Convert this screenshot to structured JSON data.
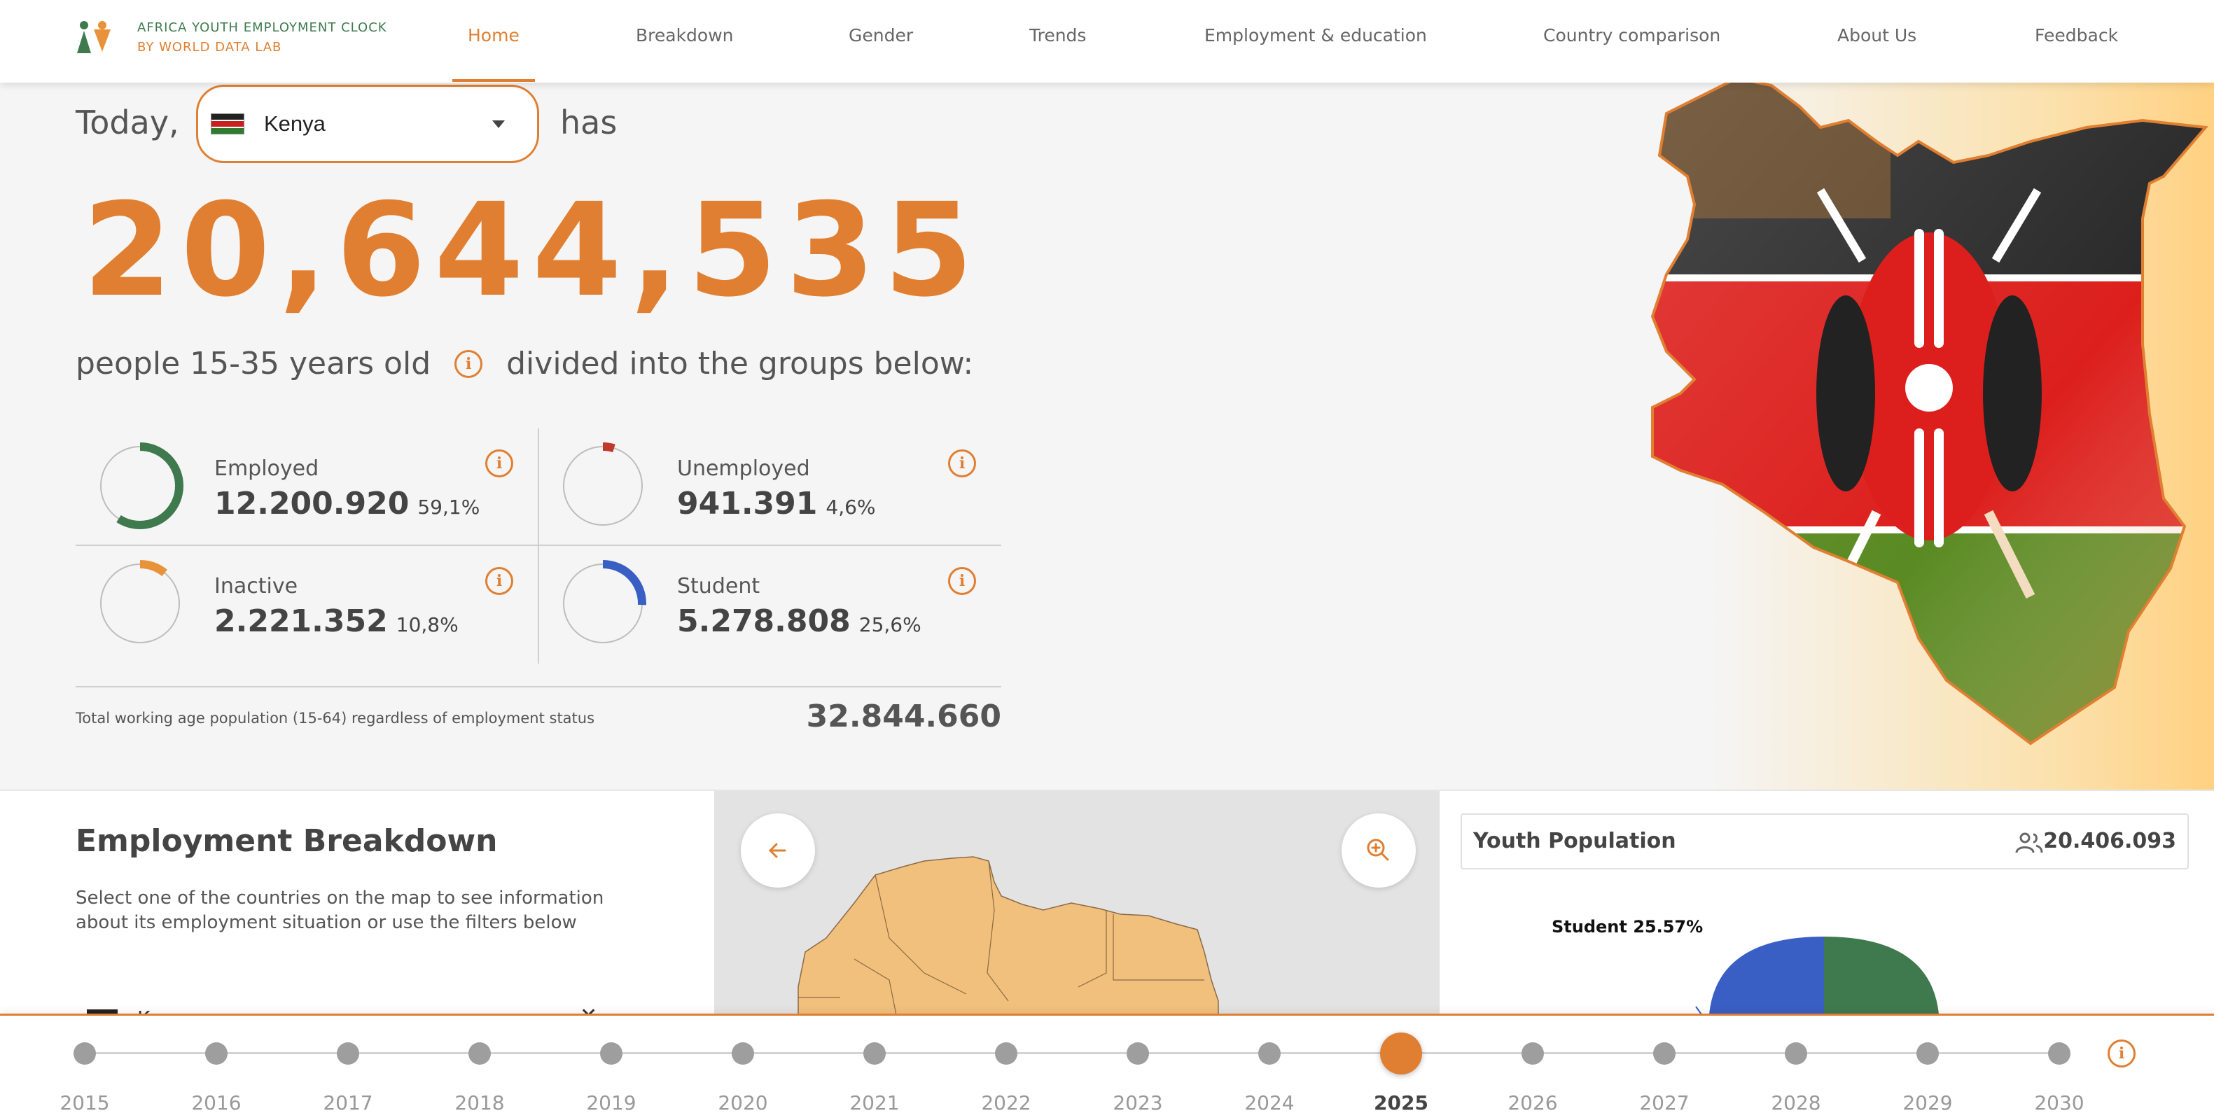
{
  "brand": {
    "line1": "AFRICA YOUTH EMPLOYMENT CLOCK",
    "line2": "BY WORLD DATA LAB"
  },
  "nav": {
    "items": [
      "Home",
      "Breakdown",
      "Gender",
      "Trends",
      "Employment & education",
      "Country comparison",
      "About Us",
      "Feedback"
    ],
    "active": "Home"
  },
  "hero": {
    "today_label": "Today,",
    "has_label": "has",
    "country_select": "Kenya",
    "youth_count": "20,644,535",
    "people_prefix": "people 15-35 years old",
    "people_suffix": "divided into the groups below:",
    "groups": [
      {
        "label": "Employed",
        "value": "12.200.920",
        "pct": "59,1%",
        "share": 0.591,
        "color": "#3f7a4f"
      },
      {
        "label": "Unemployed",
        "value": "941.391",
        "pct": "4,6%",
        "share": 0.046,
        "color": "#c0392b"
      },
      {
        "label": "Inactive",
        "value": "2.221.352",
        "pct": "10,8%",
        "share": 0.108,
        "color": "#e8933a"
      },
      {
        "label": "Student",
        "value": "5.278.808",
        "pct": "25,6%",
        "share": 0.256,
        "color": "#3a5fc4"
      }
    ],
    "total_label": "Total working age population (15-64) regardless of employment status",
    "total_value": "32.844.660",
    "colors": {
      "accent": "#e07f31",
      "green": "#3f7a4f"
    }
  },
  "breakdown": {
    "title": "Employment Breakdown",
    "description": "Select one of the countries on the map to see information about its employment situation or use the filters below",
    "country_filter": "K"
  },
  "youth_population": {
    "title": "Youth Population",
    "value": "20.406.093",
    "pie_label": "Student 25.57%"
  },
  "chart_data": {
    "type": "pie",
    "series": [
      {
        "values": [
          25.57
        ]
      }
    ],
    "categories": [
      "Student"
    ]
  },
  "timeline": {
    "years": [
      "2015",
      "2016",
      "2017",
      "2018",
      "2019",
      "2020",
      "2021",
      "2022",
      "2023",
      "2024",
      "2025",
      "2026",
      "2027",
      "2028",
      "2029",
      "2030"
    ],
    "active": "2025"
  }
}
